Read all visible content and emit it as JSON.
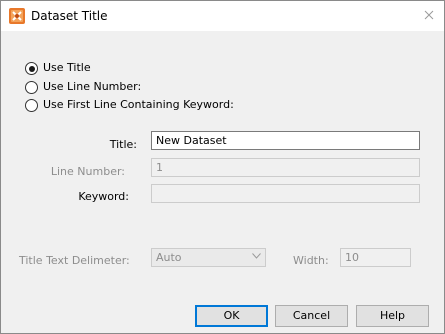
{
  "window": {
    "title": "Dataset Title",
    "close_glyph": "✕"
  },
  "options": {
    "use_title": "Use Title",
    "use_line_number": "Use Line Number:",
    "use_first_line_keyword": "Use First Line Containing Keyword:",
    "selected": "use_title"
  },
  "fields": {
    "title_label": "Title:",
    "title_value": "New Dataset",
    "line_number_label": "Line Number:",
    "line_number_value": "1",
    "keyword_label": "Keyword:",
    "keyword_value": ""
  },
  "delimiter": {
    "label": "Title Text Delimeter:",
    "value": "Auto",
    "width_label": "Width:",
    "width_value": "10"
  },
  "buttons": {
    "ok": "OK",
    "cancel": "Cancel",
    "help": "Help"
  },
  "icons": {
    "app": "tecplot-app-icon",
    "close": "close-icon",
    "dropdown": "chevron-down-icon"
  }
}
